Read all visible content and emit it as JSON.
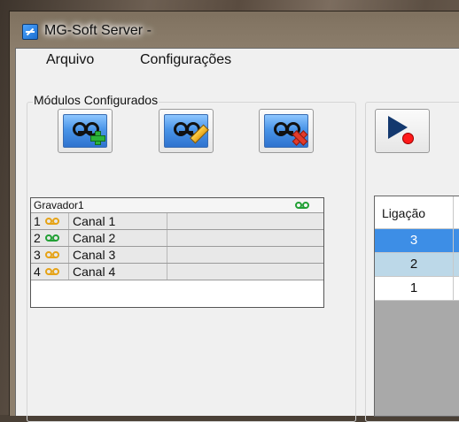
{
  "window": {
    "title": "MG-Soft Server -"
  },
  "menu": {
    "items": [
      "Arquivo",
      "Configurações"
    ]
  },
  "modules": {
    "group_label": "Módulos Configurados",
    "buttons": [
      {
        "icon": "tape-add-icon"
      },
      {
        "icon": "tape-edit-icon"
      },
      {
        "icon": "tape-delete-icon"
      }
    ],
    "recorder": {
      "name": "Gravador1",
      "status_color": "#22a035",
      "channels": [
        {
          "num": "1",
          "name": "Canal 1",
          "icon_color": "#e6a317"
        },
        {
          "num": "2",
          "name": "Canal 2",
          "icon_color": "#22a035"
        },
        {
          "num": "3",
          "name": "Canal 3",
          "icon_color": "#e6a317"
        },
        {
          "num": "4",
          "name": "Canal 4",
          "icon_color": "#e6a317"
        }
      ]
    }
  },
  "calls": {
    "play_button_icon": "play-record-icon",
    "column_header": "Ligação",
    "rows": [
      {
        "value": "3",
        "state": "selected"
      },
      {
        "value": "2",
        "state": "alternate"
      },
      {
        "value": "1",
        "state": "normal"
      }
    ]
  },
  "colors": {
    "selected": "#3d8ee6",
    "alternate": "#bcd8e8",
    "accent_blue": "#2f73cf"
  }
}
